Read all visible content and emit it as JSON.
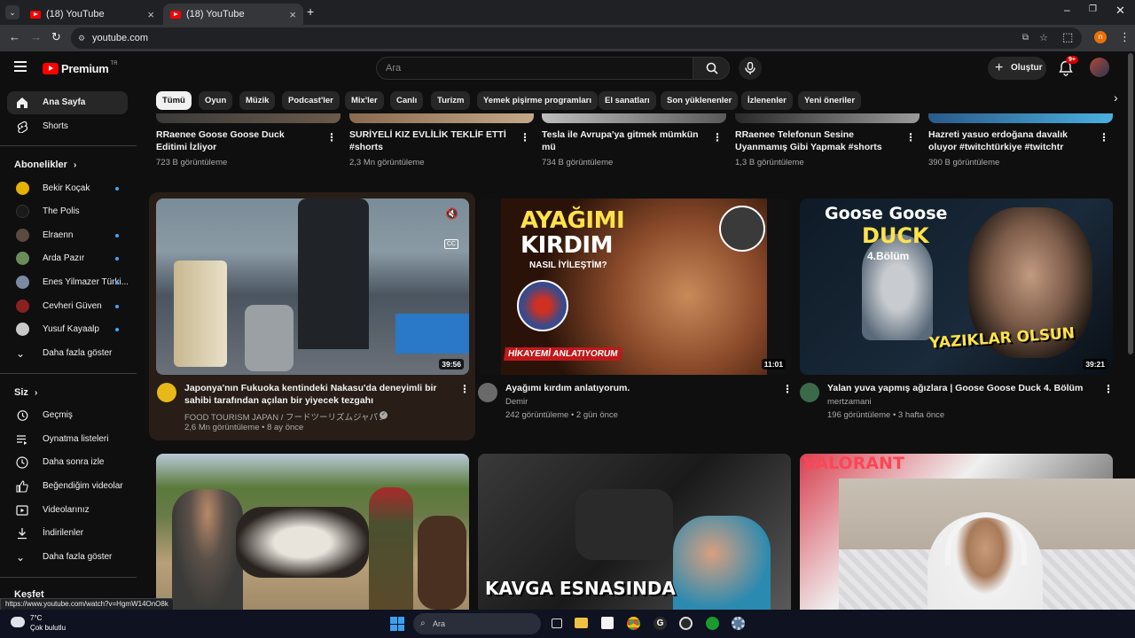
{
  "browser": {
    "tabs": [
      {
        "title": "(18) YouTube"
      },
      {
        "title": "(18) YouTube"
      }
    ],
    "url": "youtube.com",
    "status_url": "https://www.youtube.com/watch?v=HgmW14OnO8k",
    "profile_initial": "n"
  },
  "yt": {
    "logo_text": "Premium",
    "logo_sup": "TR",
    "search_placeholder": "Ara",
    "create_label": "Oluştur",
    "notif_count": "9+"
  },
  "sidebar": {
    "home": "Ana Sayfa",
    "shorts": "Shorts",
    "subs_header": "Abonelikler",
    "subs": [
      {
        "name": "Bekir Koçak",
        "color": "#e6b100",
        "new": true
      },
      {
        "name": "The Polis",
        "color": "#111111",
        "new": false
      },
      {
        "name": "Elraenn",
        "color": "#5a4a40",
        "new": true
      },
      {
        "name": "Arda Pazır",
        "color": "#6b8c5a",
        "new": true
      },
      {
        "name": "Enes Yilmazer Türki...",
        "color": "#7a8aa0",
        "new": true
      },
      {
        "name": "Cevheri Güven",
        "color": "#8a2020",
        "new": true
      },
      {
        "name": "Yusuf Kayaalp",
        "color": "#c9c9c9",
        "new": true
      }
    ],
    "subs_more": "Daha fazla göster",
    "you_header": "Siz",
    "you_items": [
      "Geçmiş",
      "Oynatma listeleri",
      "Daha sonra izle",
      "Beğendiğim videolar",
      "Videolarınız",
      "İndirilenler",
      "Daha fazla göster"
    ],
    "explore_header": "Keşfet"
  },
  "chips": [
    "Tümü",
    "Oyun",
    "Müzik",
    "Podcast'ler",
    "Mix'ler",
    "Canlı",
    "Turizm",
    "Yemek pişirme programları",
    "El sanatları",
    "Son yüklenenler",
    "İzlenenler",
    "Yeni öneriler"
  ],
  "shorts_row": [
    {
      "title": "RRaenee Goose Goose Duck Editimi İzliyor",
      "views": "723 B görüntüleme"
    },
    {
      "title": "SURİYELİ KIZ EVLİLİK TEKLİF ETTİ #shorts",
      "views": "2,3 Mn görüntüleme"
    },
    {
      "title": "Tesla ile Avrupa'ya gitmek mümkün mü",
      "views": "734 B görüntüleme"
    },
    {
      "title": "RRaenee Telefonun Sesine Uyanmamış Gibi Yapmak #shorts",
      "views": "1,3 B görüntüleme"
    },
    {
      "title": "Hazreti yasuo erdoğana davalık oluyor #twitchtürkiye #twitchtr #loltürkiye ...",
      "views": "390 B görüntüleme"
    }
  ],
  "videos": [
    {
      "title": "Japonya'nın Fukuoka kentindeki Nakasu'da deneyimli bir sahibi tarafından açılan bir yiyecek tezgahı",
      "channel": "FOOD TOURISM JAPAN / フードツーリズムジャパン",
      "meta": "2,6 Mn görüntüleme • 8 ay önce",
      "duration": "39:56"
    },
    {
      "title": "Ayağımı kırdım anlatıyorum.",
      "channel": "Demir",
      "meta": "242 görüntüleme • 2 gün önce",
      "duration": "11:01"
    },
    {
      "title": "Yalan yuva yapmış ağızlara | Goose Goose Duck 4. Bölüm",
      "channel": "mertzamani",
      "meta": "196 görüntüleme • 3 hafta önce",
      "duration": "39:21"
    }
  ],
  "thumb_text": {
    "v2_line1": "AYAĞIMI",
    "v2_line2": "KIRDIM",
    "v2_sub": "NASIL İYİLEŞTİM?",
    "v2_banner": "HİKAYEMİ ANLATIYORUM",
    "v3_line1": "Goose Goose",
    "v3_line2": "DUCK",
    "v3_line3": "4.Bölüm",
    "v3_banner": "YAZIKLAR OLSUN",
    "v5_text": "KAVGA ESNASINDA",
    "v6_text": "VALORANT"
  },
  "taskbar": {
    "temp": "7°C",
    "weather": "Çok bulutlu",
    "search": "Ara"
  }
}
